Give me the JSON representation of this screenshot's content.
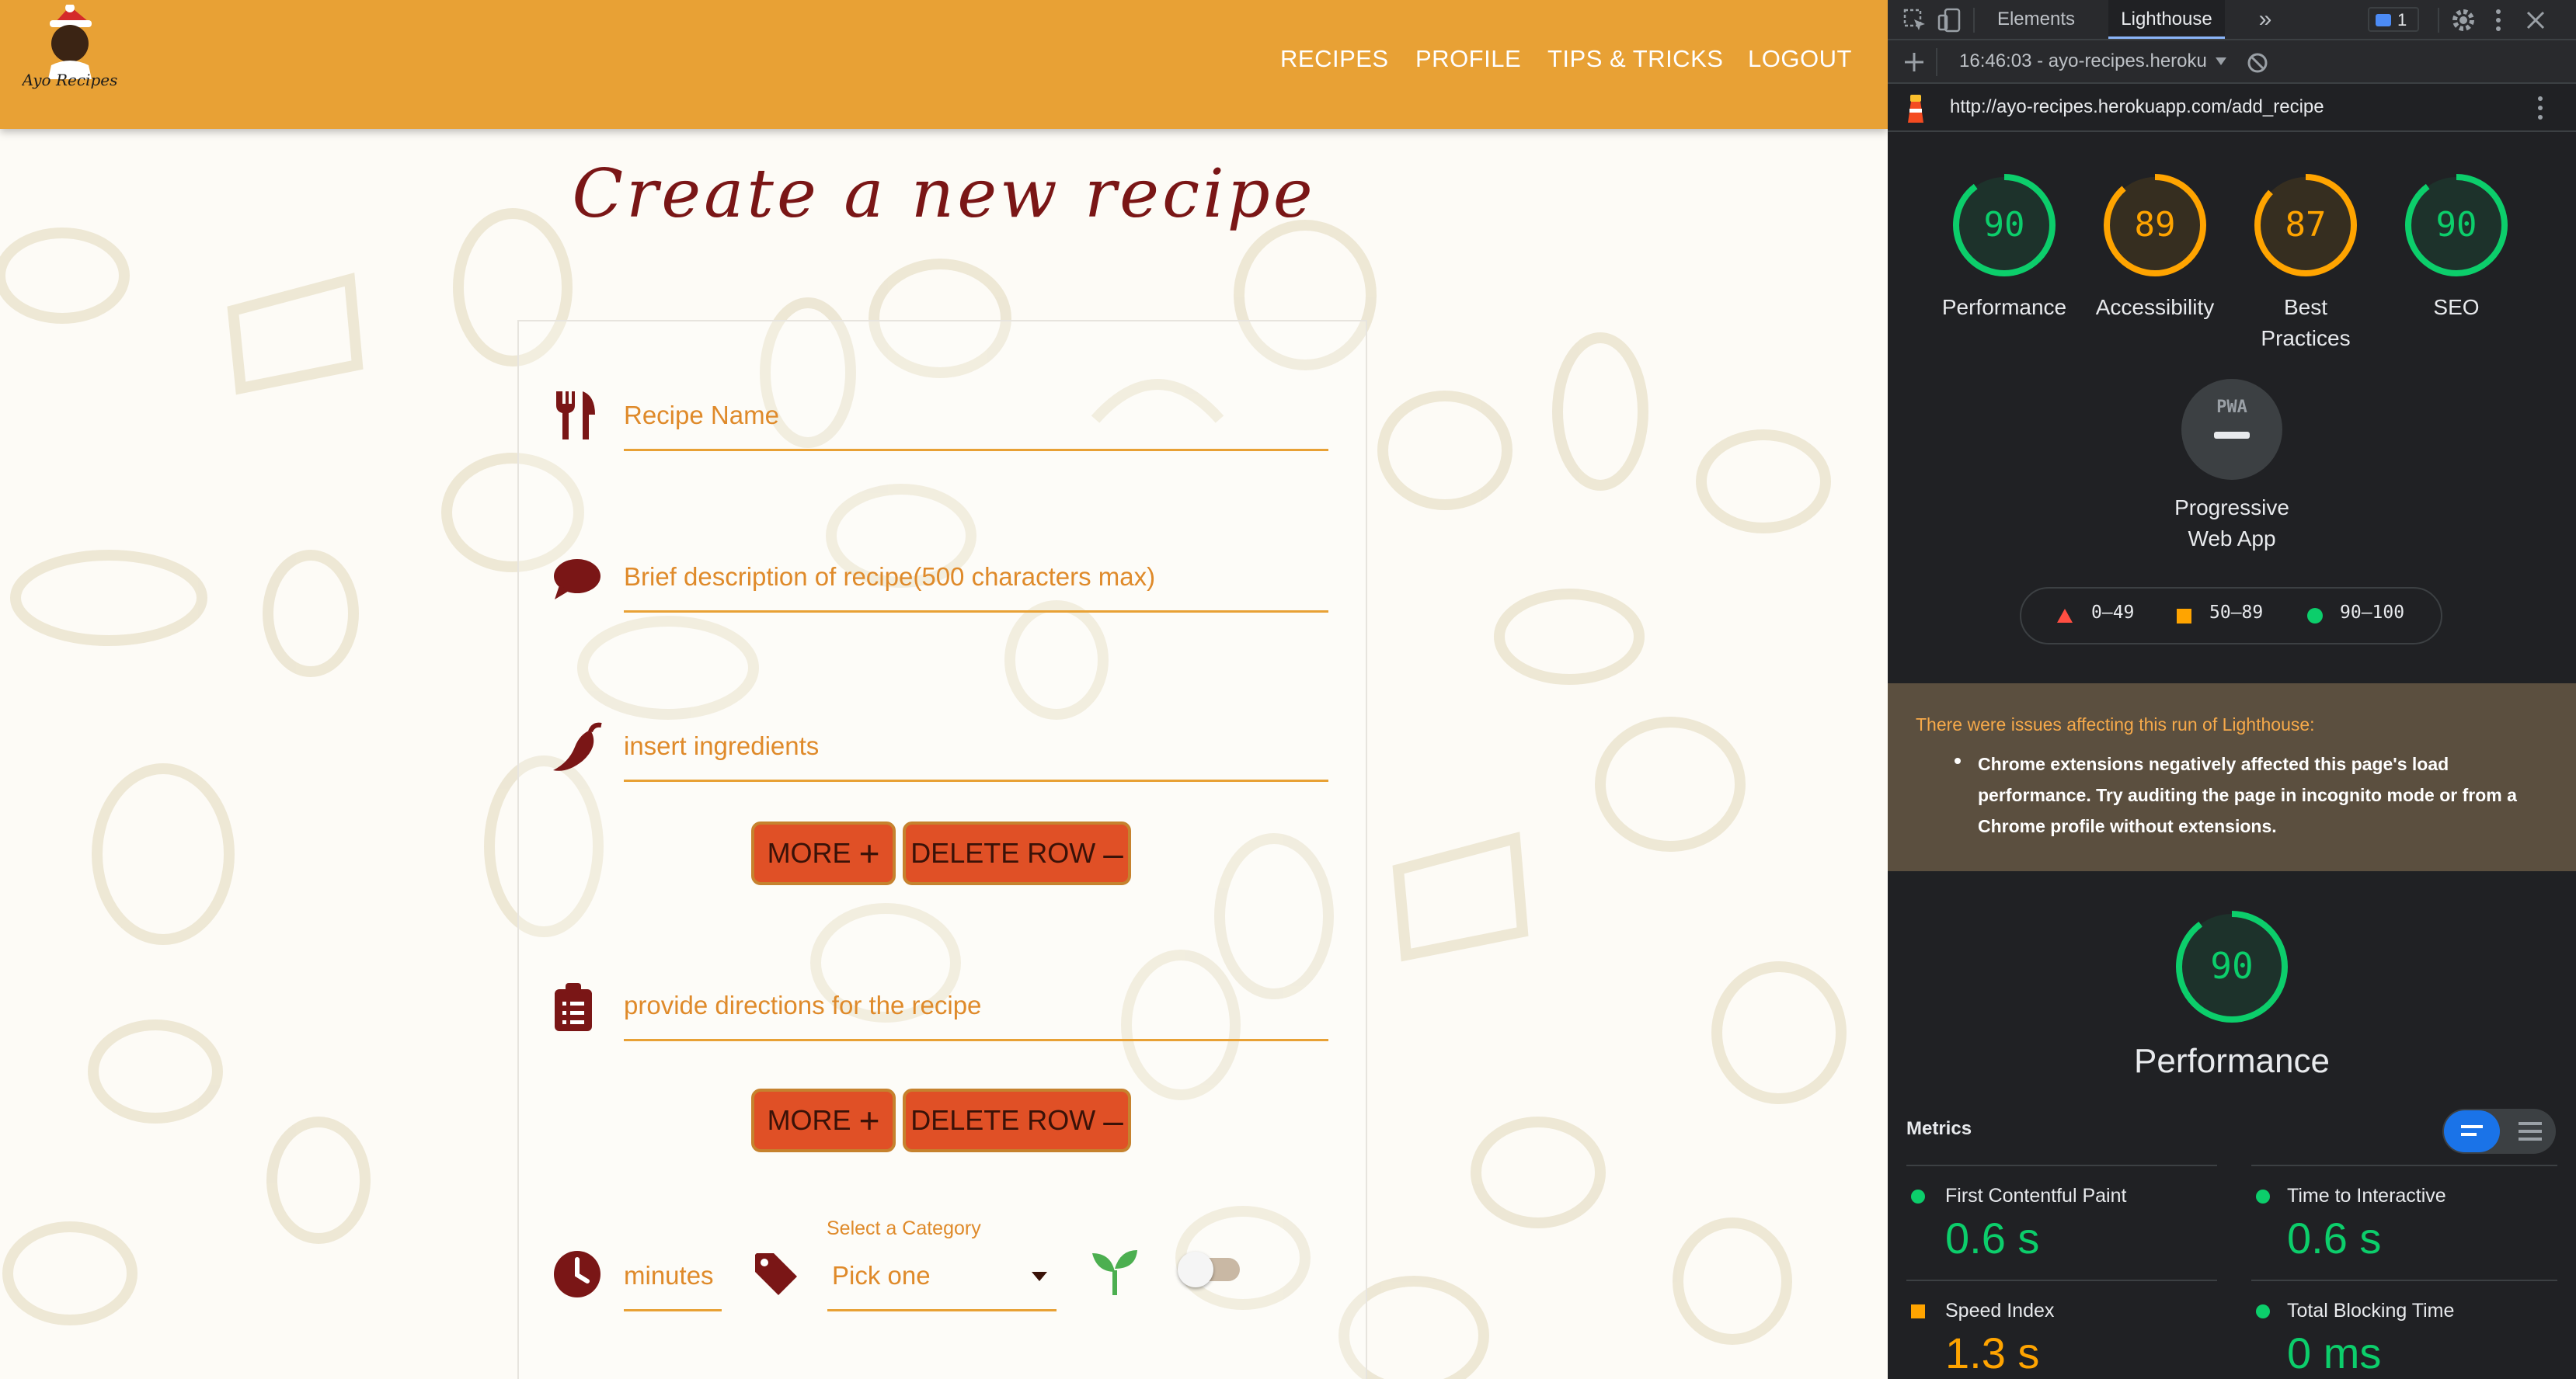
{
  "site": {
    "logo_text": "Ayo Recipes",
    "nav": [
      "RECIPES",
      "PROFILE",
      "TIPS & TRICKS",
      "LOGOUT"
    ],
    "page_title": "Create a new recipe",
    "form": {
      "recipe_name_placeholder": "Recipe Name",
      "description_placeholder": "Brief description of recipe(500 characters max)",
      "ingredients_placeholder": "insert ingredients",
      "directions_placeholder": "provide directions for the recipe",
      "more_label": "MORE",
      "delete_row_label": "DELETE ROW",
      "minutes_placeholder": "minutes",
      "category_label": "Select a Category",
      "category_value": "Pick one",
      "vegetarian_toggle": false
    },
    "colors": {
      "navbar": "#e8a135",
      "accent": "#e05026",
      "title": "#7a1616",
      "icon": "#7a1616",
      "field": "#df8a2a"
    }
  },
  "devtools": {
    "tabs": [
      "Elements",
      "Lighthouse"
    ],
    "active_tab": "Lighthouse",
    "issues_count": "1",
    "report_selector": "16:46:03 - ayo-recipes.heroku",
    "url": "http://ayo-recipes.herokuapp.com/add_recipe",
    "scores": [
      {
        "label": "Performance",
        "value": 90,
        "color": "#0cce6b"
      },
      {
        "label": "Accessibility",
        "value": 89,
        "color": "#ffa400"
      },
      {
        "label_line1": "Best",
        "label_line2": "Practices",
        "value": 87,
        "color": "#ffa400"
      },
      {
        "label": "SEO",
        "value": 90,
        "color": "#0cce6b"
      }
    ],
    "pwa": {
      "badge": "PWA",
      "label_line1": "Progressive",
      "label_line2": "Web App"
    },
    "legend": [
      "0–49",
      "50–89",
      "90–100"
    ],
    "warning": {
      "title": "There were issues affecting this run of Lighthouse:",
      "line1": "Chrome extensions negatively affected this page's load",
      "line2": "performance. Try auditing the page in incognito mode or from a",
      "line3": "Chrome profile without extensions."
    },
    "performance": {
      "score": 90,
      "title": "Performance"
    },
    "metrics_title": "Metrics",
    "metrics": [
      {
        "name": "First Contentful Paint",
        "value": "0.6 s",
        "status": "green"
      },
      {
        "name": "Time to Interactive",
        "value": "0.6 s",
        "status": "green"
      },
      {
        "name": "Speed Index",
        "value": "1.3 s",
        "status": "orange"
      },
      {
        "name": "Total Blocking Time",
        "value": "0 ms",
        "status": "green"
      }
    ]
  }
}
